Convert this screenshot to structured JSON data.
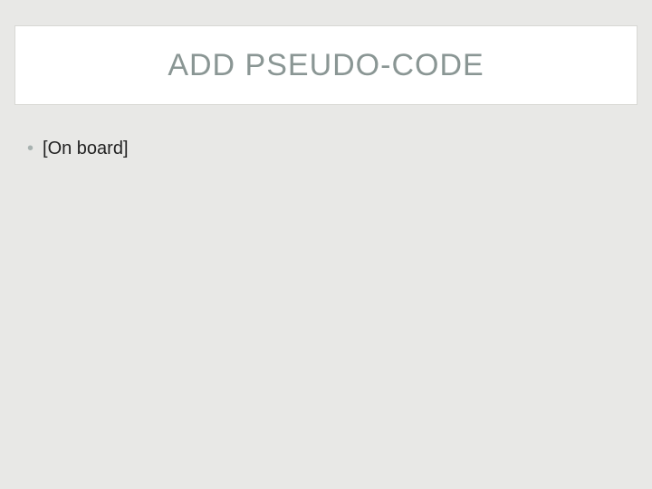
{
  "slide": {
    "title": "ADD PSEUDO-CODE",
    "bullets": [
      {
        "text": "[On board]"
      }
    ]
  }
}
